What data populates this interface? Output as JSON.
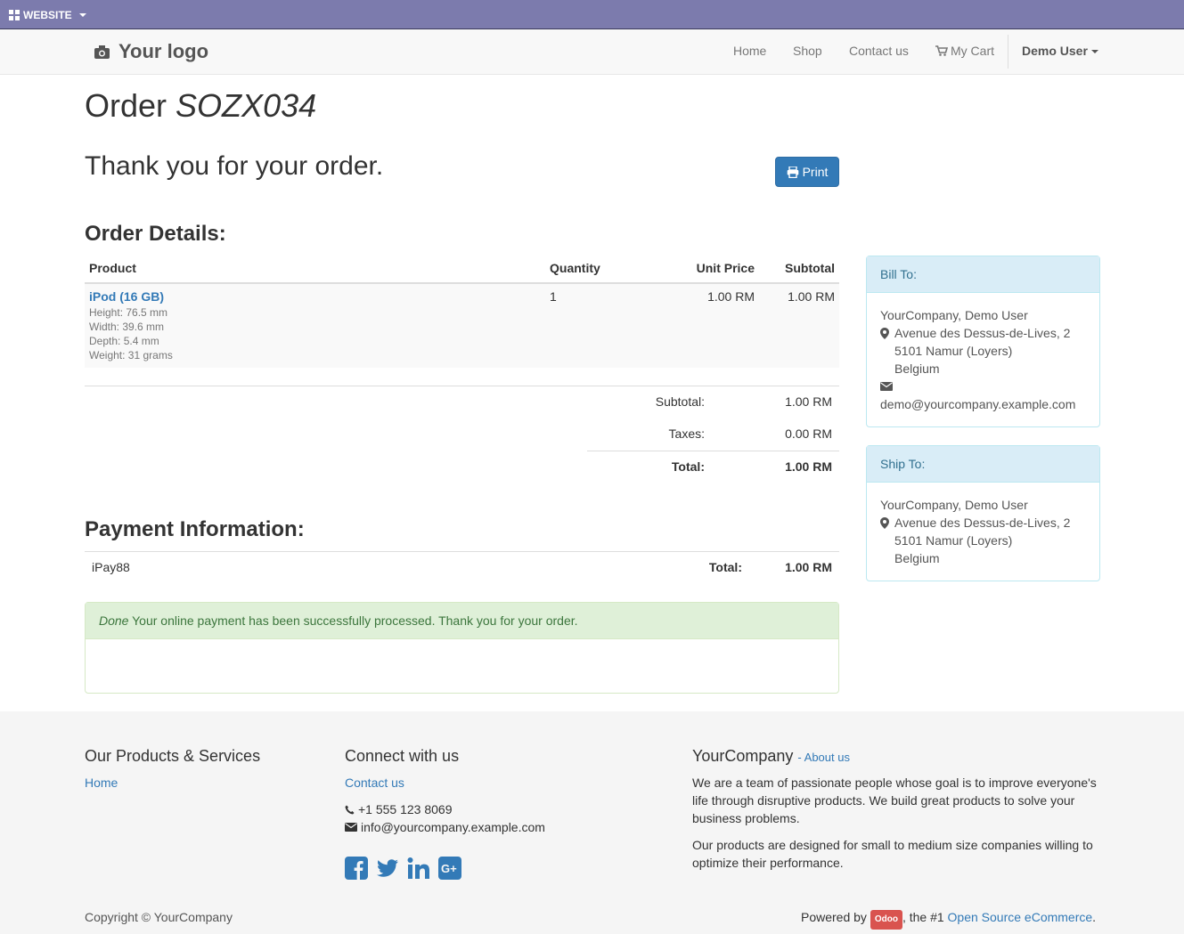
{
  "topbar": {
    "website_label": "WEBSITE"
  },
  "navbar": {
    "logo_text": "Your logo",
    "items": [
      {
        "label": "Home"
      },
      {
        "label": "Shop"
      },
      {
        "label": "Contact us"
      },
      {
        "label": "My Cart"
      }
    ],
    "user": "Demo User"
  },
  "page": {
    "title_prefix": "Order",
    "order_ref": "SOZX034",
    "thanks": "Thank you for your order.",
    "print_label": "Print"
  },
  "order_details": {
    "heading": "Order Details:",
    "columns": [
      "Product",
      "Quantity",
      "Unit Price",
      "Subtotal"
    ],
    "line": {
      "product": "iPod (16 GB)",
      "specs": [
        "Height: 76.5 mm",
        "Width: 39.6 mm",
        "Depth: 5.4 mm",
        "Weight: 31 grams"
      ],
      "quantity": "1",
      "unit_price": "1.00 RM",
      "subtotal": "1.00 RM"
    },
    "totals": {
      "subtotal_label": "Subtotal:",
      "subtotal": "1.00 RM",
      "taxes_label": "Taxes:",
      "taxes": "0.00 RM",
      "total_label": "Total:",
      "total": "1.00 RM"
    }
  },
  "payment": {
    "heading": "Payment Information:",
    "method": "iPay88",
    "total_label": "Total:",
    "total": "1.00 RM",
    "status_word": "Done",
    "status_message": " Your online payment has been successfully processed. Thank you for your order."
  },
  "bill_to": {
    "title": "Bill To:",
    "name": "YourCompany, Demo User",
    "street": "Avenue des Dessus-de-Lives, 2",
    "city": "5101 Namur (Loyers)",
    "country": "Belgium",
    "email": "demo@yourcompany.example.com"
  },
  "ship_to": {
    "title": "Ship To:",
    "name": "YourCompany, Demo User",
    "street": "Avenue des Dessus-de-Lives, 2",
    "city": "5101 Namur (Loyers)",
    "country": "Belgium"
  },
  "footer": {
    "col1_title": "Our Products & Services",
    "col1_link": "Home",
    "col2_title": "Connect with us",
    "col2_link": "Contact us",
    "phone": "+1 555 123 8069",
    "email": "info@yourcompany.example.com",
    "col3_title": "YourCompany",
    "col3_link": "About us",
    "para1": "We are a team of passionate people whose goal is to improve everyone's life through disruptive products. We build great products to solve your business problems.",
    "para2": "Our products are designed for small to medium size companies willing to optimize their performance.",
    "copyright": "Copyright © YourCompany",
    "powered_by": "Powered by",
    "odoo": "Odoo",
    "the_1": ", the #1",
    "oss_link": "Open Source eCommerce",
    "period": "."
  },
  "colors": {
    "topbar": "#7c7bad",
    "link": "#337ab7",
    "success_bg": "#dff0d8",
    "info_bg": "#d9edf7",
    "odoo_badge": "#d9534f"
  }
}
